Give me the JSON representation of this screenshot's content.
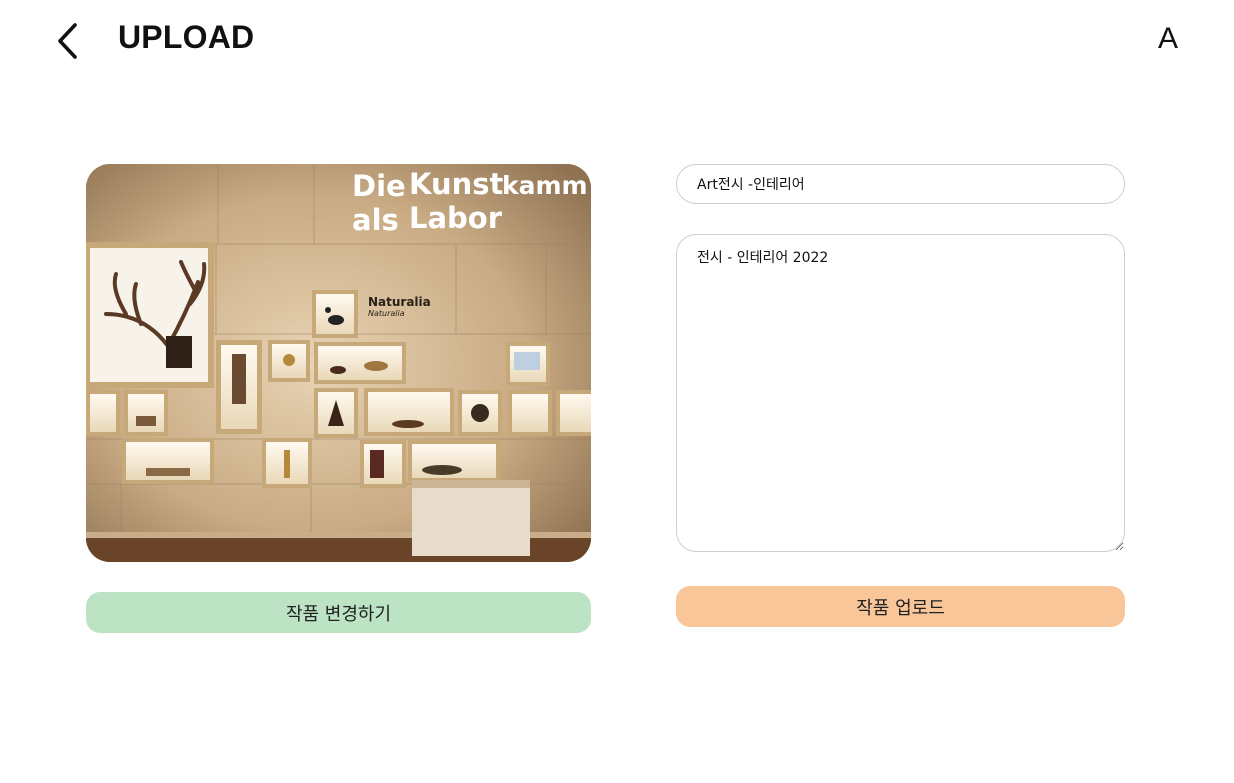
{
  "header": {
    "title": "UPLOAD",
    "back_icon": "chevron-left-icon",
    "avatar_letter": "A"
  },
  "artwork": {
    "image_subject": "museum gallery wall with illuminated display cases",
    "sign_line1_a": "Die",
    "sign_line1_b": "Kunst",
    "sign_line1_c": "kamm",
    "sign_line2_a": "als",
    "sign_line2_b": "Labor",
    "label_title": "Naturalia",
    "label_subtitle": "Naturalia",
    "change_button_label": "작품 변경하기"
  },
  "form": {
    "title_value": "Art전시 -인테리어",
    "description_value": "전시 - 인테리어 2022",
    "upload_button_label": "작품 업로드"
  },
  "colors": {
    "change_button": "#bce3c3",
    "upload_button": "#f8c699",
    "input_border": "#cfcfcf"
  }
}
